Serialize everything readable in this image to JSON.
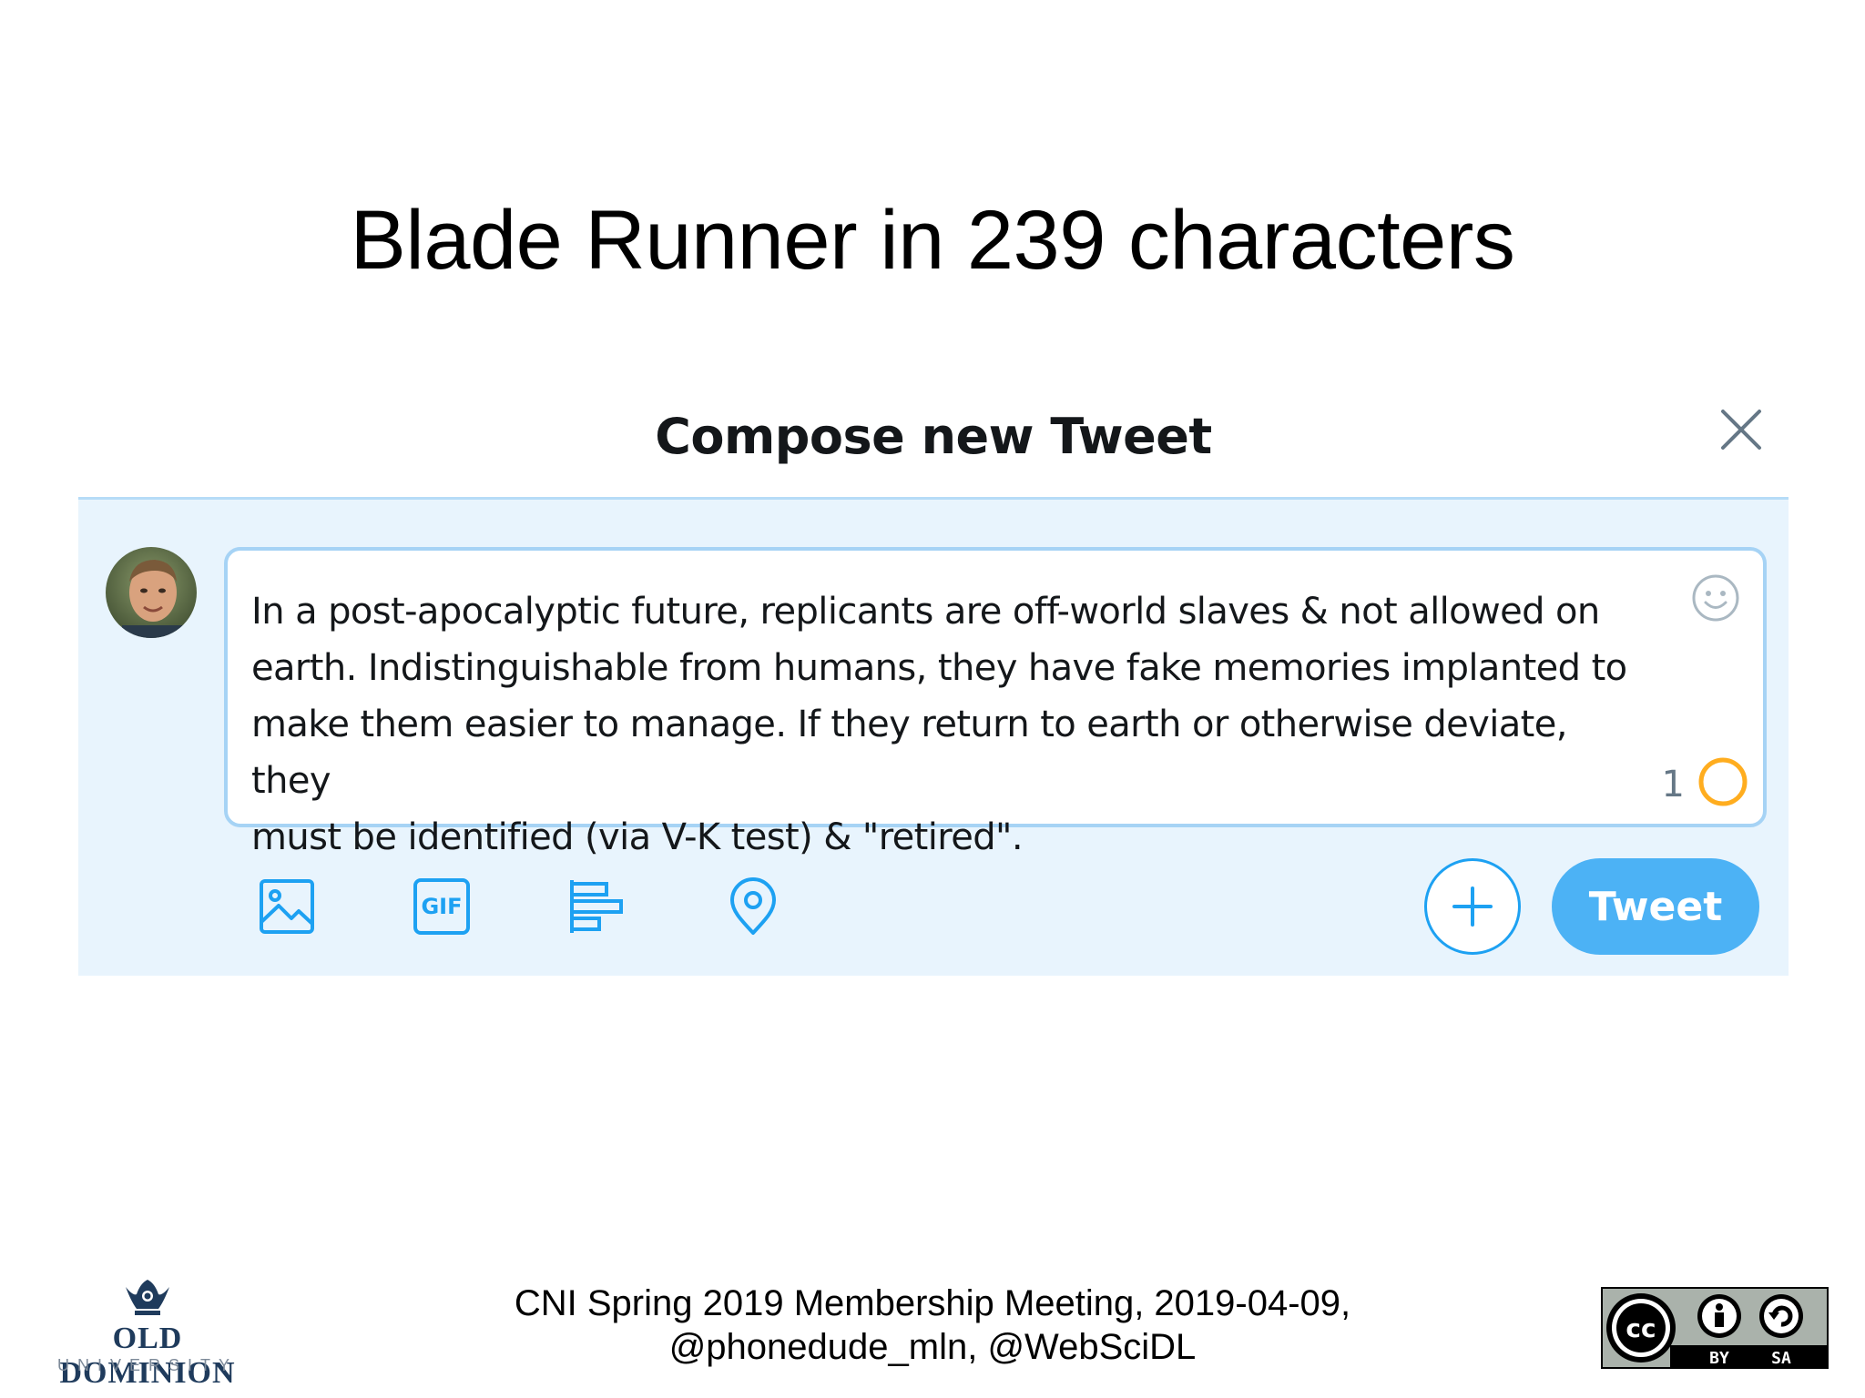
{
  "slide": {
    "title": "Blade Runner in 239 characters"
  },
  "compose": {
    "header_title": "Compose new Tweet",
    "close_icon": "close-icon",
    "tweet_text_lines": [
      "In a post-apocalyptic future, replicants are off-world slaves & not allowed on",
      "earth. Indistinguishable from humans, they have fake memories implanted to",
      "make them easier to manage. If they return to earth or otherwise deviate, they",
      "must be identified (via V-K test) & \"retired\"."
    ],
    "remaining_count": "1",
    "emoji_icon": "smiley-icon",
    "toolbar": {
      "icons": [
        "image-icon",
        "gif-icon",
        "poll-icon",
        "location-icon"
      ],
      "gif_label": "GIF",
      "add_icon": "plus-icon",
      "tweet_label": "Tweet"
    },
    "colors": {
      "accent": "#1da1f2",
      "button": "#4cb2f5",
      "panel": "#e8f4fd",
      "progress_ring": "#ffad1f"
    }
  },
  "footer": {
    "line1": "CNI Spring 2019 Membership Meeting, 2019-04-09,",
    "line2": "@phonedude_mln, @WebSciDL",
    "logo_line1": "OLD DOMINION",
    "logo_line2": "UNIVERSITY",
    "license_labels": [
      "cc",
      "BY",
      "SA"
    ]
  }
}
